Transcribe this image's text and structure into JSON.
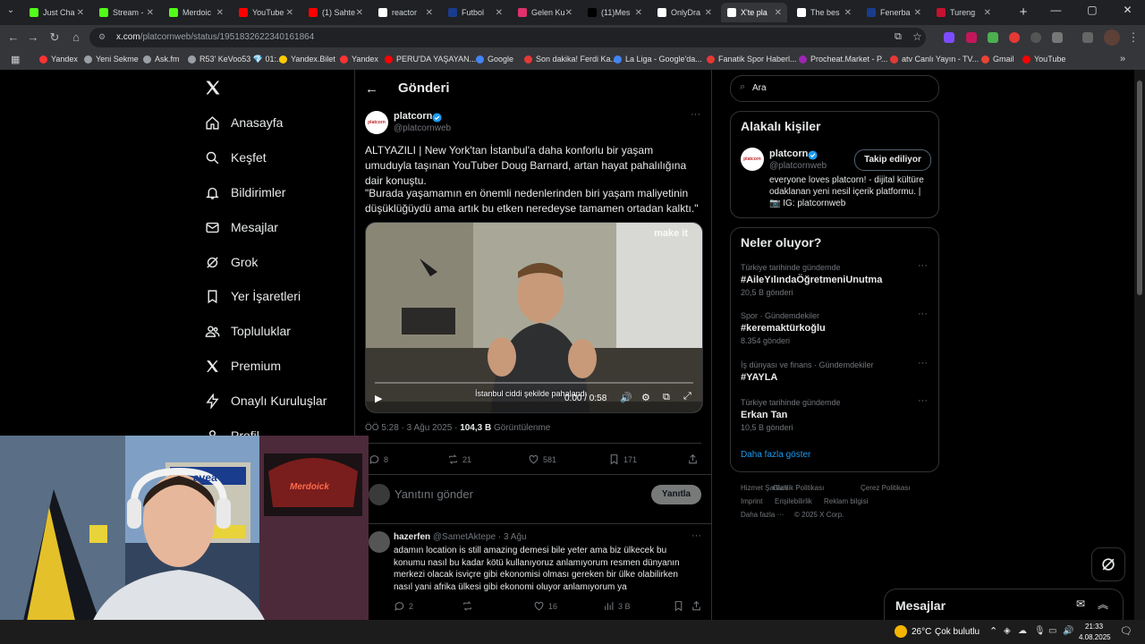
{
  "browser": {
    "tabs": [
      {
        "label": "Just Cha",
        "color": "#53fc18",
        "active": false
      },
      {
        "label": "Stream -",
        "color": "#53fc18",
        "active": false
      },
      {
        "label": "Merdoic",
        "color": "#53fc18",
        "active": false
      },
      {
        "label": "YouTube",
        "color": "#ff0000",
        "active": false
      },
      {
        "label": "(1) Sahte",
        "color": "#ff0000",
        "active": false
      },
      {
        "label": "reactor",
        "color": "#ffffff",
        "active": false
      },
      {
        "label": "Futbol",
        "color": "#1a3c8c",
        "active": false
      },
      {
        "label": "Gelen Ku",
        "color": "#e1306c",
        "active": false
      },
      {
        "label": "(11)Mes",
        "color": "#000000",
        "active": false
      },
      {
        "label": "OnlyDra",
        "color": "#ffffff",
        "active": false
      },
      {
        "label": "X'te pla",
        "color": "#ffffff",
        "active": true
      },
      {
        "label": "The bes",
        "color": "#ffffff",
        "active": false
      },
      {
        "label": "Fenerba",
        "color": "#1a3c8c",
        "active": false
      },
      {
        "label": "Tureng",
        "color": "#c4122f",
        "active": false
      }
    ],
    "url_host": "x.com",
    "url_path": "/platcornweb/status/1951832622340161864",
    "bookmarks": [
      {
        "label": "Yandex",
        "color": "#ff3333"
      },
      {
        "label": "Yeni Sekme",
        "color": "#9aa0a6"
      },
      {
        "label": "Ask.fm",
        "color": "#9aa0a6"
      },
      {
        "label": "R53' KeVoo53 💎 01:...",
        "color": "#9aa0a6"
      },
      {
        "label": "Yandex.Bilet",
        "color": "#ffcc00"
      },
      {
        "label": "Yandex",
        "color": "#ff3333"
      },
      {
        "label": "PERU'DA YAŞAYAN...",
        "color": "#ff0000"
      },
      {
        "label": "Google",
        "color": "#4285f4"
      },
      {
        "label": "Son dakika! Ferdi Ka...",
        "color": "#e53935"
      },
      {
        "label": "La Liga - Google'da...",
        "color": "#4285f4"
      },
      {
        "label": "Fanatik Spor Haberl...",
        "color": "#e53935"
      },
      {
        "label": "Procheat.Market - P...",
        "color": "#9c27b0"
      },
      {
        "label": "atv Canlı Yayın - TV...",
        "color": "#e53935"
      },
      {
        "label": "Gmail",
        "color": "#ea4335"
      },
      {
        "label": "YouTube",
        "color": "#ff0000"
      }
    ]
  },
  "sidebar": {
    "items": [
      {
        "label": "Anasayfa",
        "icon": "home-icon"
      },
      {
        "label": "Keşfet",
        "icon": "search-icon"
      },
      {
        "label": "Bildirimler",
        "icon": "bell-icon"
      },
      {
        "label": "Mesajlar",
        "icon": "mail-icon"
      },
      {
        "label": "Grok",
        "icon": "grok-icon"
      },
      {
        "label": "Yer İşaretleri",
        "icon": "bookmark-icon"
      },
      {
        "label": "Topluluklar",
        "icon": "people-icon"
      },
      {
        "label": "Premium",
        "icon": "x-logo-icon"
      },
      {
        "label": "Onaylı Kuruluşlar",
        "icon": "lightning-icon"
      },
      {
        "label": "Profil",
        "icon": "person-icon"
      }
    ]
  },
  "main": {
    "header_title": "Gönderi",
    "tweet": {
      "name": "platcorn",
      "handle": "@platcornweb",
      "avatar_text": "platcorn",
      "text1": "ALTYAZILI | New York'tan İstanbul'a daha konforlu bir yaşam umuduyla taşınan YouTuber Doug Barnard, artan hayat pahalılığına dair konuştu.",
      "text2": "\"Burada yaşamamın en önemli nedenlerinden biri yaşam maliyetinin düşüklüğüydü ama artık bu etken neredeyse tamamen ortadan kalktı.\"",
      "video_watermark": "make it",
      "video_subtitle": "İstanbul ciddi şekilde pahalandı",
      "video_time": "0:00 / 0:58",
      "meta_time": "ÖÖ 5:28 · 3 Ağu 2025 ·",
      "views_count": "104,3 B",
      "views_label": "Görüntülenme",
      "replies": "8",
      "retweets": "21",
      "likes": "581",
      "bookmarks": "171"
    },
    "reply_placeholder": "Yanıtını gönder",
    "reply_button": "Yanıtla",
    "comment": {
      "name": "hazerfen",
      "handle": "@SametAktepe",
      "date": "· 3 Ağu",
      "text": "adamın location is still amazing demesi bile yeter ama biz ülkecek bu konumu nasıl bu kadar kötü kullanıyoruz anlamıyorum resmen dünyanın merkezi olacak isviçre gibi ekonomisi olması gereken bir ülke olabilirken nasıl yani afrika ülkesi gibi ekonomi oluyor anlamıyorum ya",
      "replies": "2",
      "likes": "16",
      "views": "3 B"
    }
  },
  "right": {
    "search_placeholder": "Ara",
    "related_title": "Alakalı kişiler",
    "related": {
      "name": "platcorn",
      "handle": "@platcornweb",
      "follow_label": "Takip ediliyor",
      "bio": "everyone loves platcorn! - dijital kültüre odaklanan yeni nesil içerik platformu. | 📷 IG: platcornweb"
    },
    "trends_title": "Neler oluyor?",
    "trends": [
      {
        "meta": "Türkiye tarihinde gündemde",
        "tag": "#AileYılındaÖğretmeniUnutma",
        "count": "20,5 B gönderi"
      },
      {
        "meta": "Spor · Gündemdekiler",
        "tag": "#keremaktürkoğlu",
        "count": "8.354 gönderi"
      },
      {
        "meta": "İş dünyası ve finans · Gündemdekiler",
        "tag": "#YAYLA",
        "count": ""
      },
      {
        "meta": "Türkiye tarihinde gündemde",
        "tag": "Erkan Tan",
        "count": "10,5 B gönderi"
      }
    ],
    "show_more": "Daha fazla göster",
    "footer": [
      "Hizmet Şartları",
      "Gizlilik Politikası",
      "Çerez Politikası",
      "Imprint",
      "Erişilebilirlik",
      "Reklam bilgisi",
      "Daha fazla ···",
      "© 2025 X Corp."
    ],
    "messages_label": "Mesajlar"
  },
  "webcam": {
    "sign_text": "Merdoick",
    "poster_text": "avea"
  },
  "taskbar": {
    "weather": "26°C",
    "weather_desc": "Çok bulutlu",
    "time": "21:33",
    "date": "4.08.2025"
  }
}
